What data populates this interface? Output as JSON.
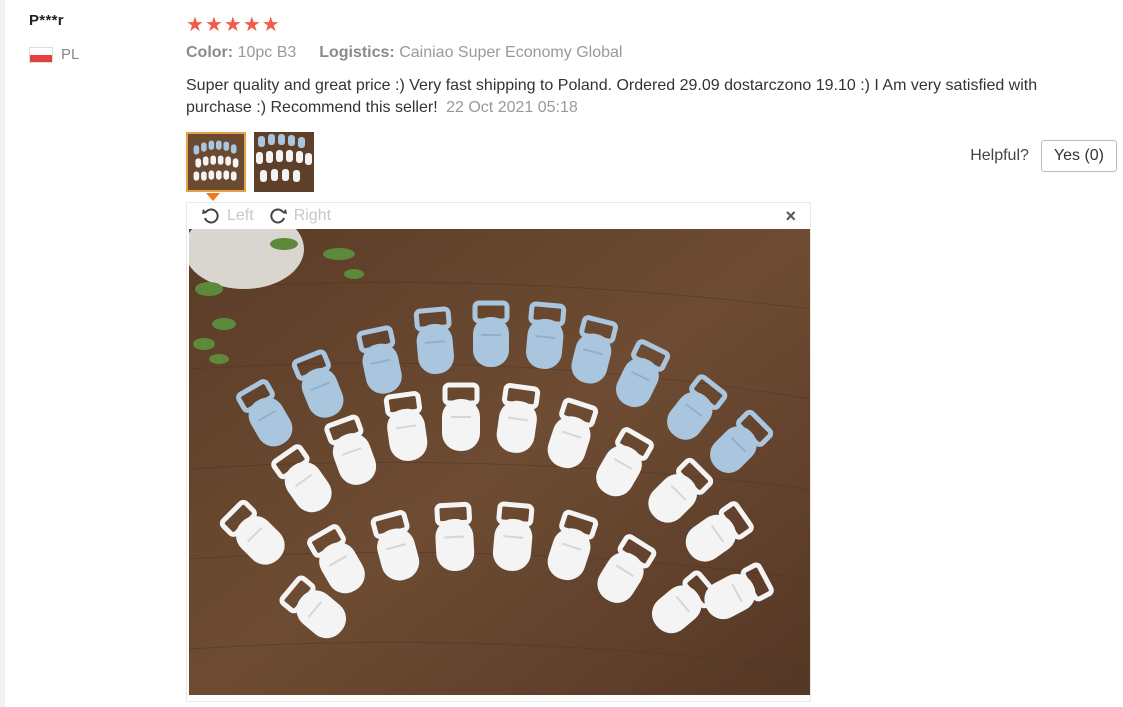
{
  "reviewer": {
    "name": "P***r",
    "country_code": "PL"
  },
  "rating": {
    "stars": 5,
    "max": 5,
    "star_color": "#f25a4a"
  },
  "meta": {
    "color_label": "Color:",
    "color_value": "10pc B3",
    "logistics_label": "Logistics:",
    "logistics_value": "Cainiao Super Economy Global"
  },
  "review": {
    "text": "Super quality and great price :) Very fast shipping to Poland. Ordered 29.09 dostarczono 19.10 :) I Am very satisfied with purchase :) Recommend this seller!",
    "date": "22 Oct 2021 05:18"
  },
  "photos": [
    {
      "id": "photo-1",
      "selected": true
    },
    {
      "id": "photo-2",
      "selected": false
    }
  ],
  "helpful": {
    "label": "Helpful?",
    "yes_button": "Yes (0)"
  },
  "viewer": {
    "rotate_left_label": "Left",
    "rotate_right_label": "Right",
    "close_symbol": "×",
    "icons": {
      "rotate_left": "rotate-left-icon",
      "rotate_right": "rotate-right-icon",
      "close": "close-icon"
    }
  },
  "colors": {
    "accent_orange": "#f27a1a",
    "thumb_border": "#e6a04a",
    "wood": "#6b4a32",
    "clip_blue": "#a9c6de",
    "clip_white": "#f4f4f4"
  }
}
